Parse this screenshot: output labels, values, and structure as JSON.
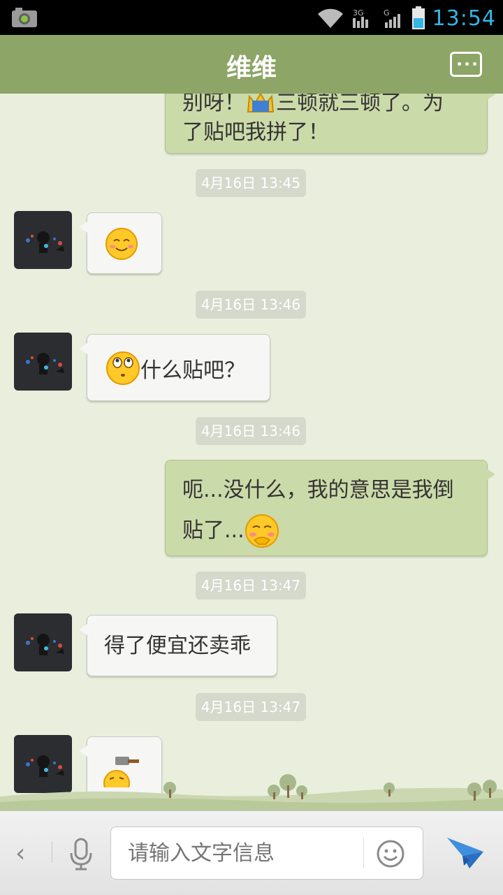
{
  "status_bar": {
    "time": "13:54",
    "network_3g": "3G",
    "network_g": "G"
  },
  "header": {
    "title": "维维"
  },
  "messages": {
    "out1": {
      "line1": "别呀！",
      "line1b": "三顿就三顿了。为",
      "line2": "了贴吧我拼了！"
    },
    "ts1": "4月16日 13:45",
    "ts2": "4月16日 13:46",
    "in2": {
      "text": "什么贴吧？"
    },
    "ts3": "4月16日 13:46",
    "out2": {
      "line1": "呃...没什么，我的意思是我倒",
      "line2": "贴了..."
    },
    "ts4": "4月16日 13:47",
    "in3": {
      "text": "得了便宜还卖乖"
    },
    "ts5": "4月16日 13:47"
  },
  "input_bar": {
    "placeholder": "请输入文字信息"
  },
  "colors": {
    "header": "#8da567",
    "background": "#e9efdc",
    "outgoing_bubble": "#cbdaa9",
    "incoming_bubble": "#f6f6f4",
    "time": "#33b5e5"
  },
  "icons": [
    "screenshot-icon",
    "wifi-icon",
    "signal-icon",
    "battery-icon",
    "more-icon",
    "mic-icon",
    "smiley-icon",
    "send-icon",
    "back-icon"
  ]
}
